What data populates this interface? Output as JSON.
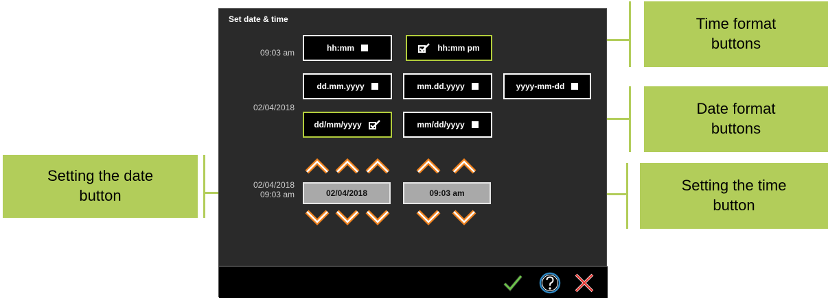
{
  "dialog": {
    "title": "Set date & time",
    "current_time": "09:03 am",
    "current_date": "02/04/2018",
    "setter_date_label": "02/04/2018",
    "setter_time_label": "09:03 am"
  },
  "time_formats": [
    {
      "label": "hh:mm",
      "selected": false
    },
    {
      "label": "hh:mm pm",
      "selected": true
    }
  ],
  "date_formats": [
    {
      "label": "dd.mm.yyyy",
      "selected": false
    },
    {
      "label": "mm.dd.yyyy",
      "selected": false
    },
    {
      "label": "yyyy-mm-dd",
      "selected": false
    },
    {
      "label": "dd/mm/yyyy",
      "selected": true
    },
    {
      "label": "mm/dd/yyyy",
      "selected": false
    }
  ],
  "setters": {
    "date_value": "02/04/2018",
    "time_value": "09:03 am"
  },
  "callouts": {
    "time_format_line1": "Time format",
    "time_format_line2": "buttons",
    "date_format_line1": "Date format",
    "date_format_line2": "buttons",
    "set_date_line1": "Setting the date",
    "set_date_line2": "button",
    "set_time_line1": "Setting the time",
    "set_time_line2": "button"
  },
  "colors": {
    "accent_green": "#b2cd3c",
    "callout_green": "#b2cd5a",
    "arrow_orange": "#f0821e",
    "panel_bg": "#2a2a2a"
  },
  "icons": {
    "confirm": "check-icon",
    "help": "help-icon",
    "cancel": "close-icon",
    "increment": "chevron-up-icon",
    "decrement": "chevron-down-icon"
  }
}
